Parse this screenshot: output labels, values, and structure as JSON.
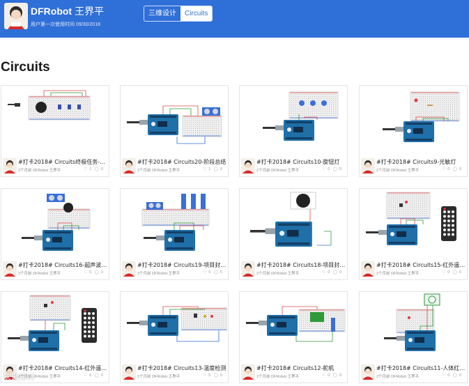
{
  "header": {
    "brand": "DFRobot",
    "user_cn": "王界平",
    "first_use": "用户第一次使用时间 09/30/2018",
    "tabs": [
      {
        "label": "三维设计",
        "active": false
      },
      {
        "label": "Circuits",
        "active": true
      }
    ],
    "bar_color": "#2f6fd8"
  },
  "section_title": "Circuits",
  "cards": [
    {
      "title": "#打卡2018# Circuits终极任务-灯…",
      "meta": "2个月前 DFRobot 王界平",
      "likes": "1",
      "comments": "0",
      "variant": "buzzer"
    },
    {
      "title": "#打卡2018# Circuits20-阶段总结",
      "meta": "2个月前 DFRobot 王界平",
      "likes": "1",
      "comments": "0",
      "variant": "ultrasonic"
    },
    {
      "title": "#打卡2018# Circuits10-旋钮灯",
      "meta": "2个月前 DFRobot 王界平",
      "likes": "0",
      "comments": "0",
      "variant": "pots"
    },
    {
      "title": "#打卡2018# Circuits9-光敏灯",
      "meta": "2个月前 DFRobot 王界平",
      "likes": "0",
      "comments": "0",
      "variant": "led"
    },
    {
      "title": "#打卡2018# Circuits16-超声波倒…",
      "meta": "2个月前 DFRobot 王界平",
      "likes": "0",
      "comments": "0",
      "variant": "ultrasonic-buzzer"
    },
    {
      "title": "#打卡2018# Circuits19-项目封装…",
      "meta": "2个月前 DFRobot 王界平",
      "likes": "0",
      "comments": "0",
      "variant": "servos"
    },
    {
      "title": "#打卡2018# Circuits18-项目封装…",
      "meta": "2个月前 DFRobot 王界平",
      "likes": "0",
      "comments": "0",
      "variant": "big-buzzer"
    },
    {
      "title": "#打卡2018# Circuits15-红外遥控…",
      "meta": "2个月前 DFRobot 王界平",
      "likes": "0",
      "comments": "0",
      "variant": "remote"
    },
    {
      "title": "#打卡2018# Circuits14-红外遥控…",
      "meta": "2个月前 DFRobot 王界平",
      "likes": "0",
      "comments": "0",
      "variant": "remote2"
    },
    {
      "title": "#打卡2018# Circuits13-温度检测",
      "meta": "2个月前 DFRobot 王界平",
      "likes": "0",
      "comments": "0",
      "variant": "temp"
    },
    {
      "title": "#打卡2018# Circuits12-舵机",
      "meta": "2个月前 DFRobot 王界平",
      "likes": "0",
      "comments": "0",
      "variant": "servo"
    },
    {
      "title": "#打卡2018# Circuits11-人体红外…",
      "meta": "2个月前 DFRobot 王界平",
      "likes": "0",
      "comments": "0",
      "variant": "pir"
    }
  ],
  "watermark": "天政研讨"
}
